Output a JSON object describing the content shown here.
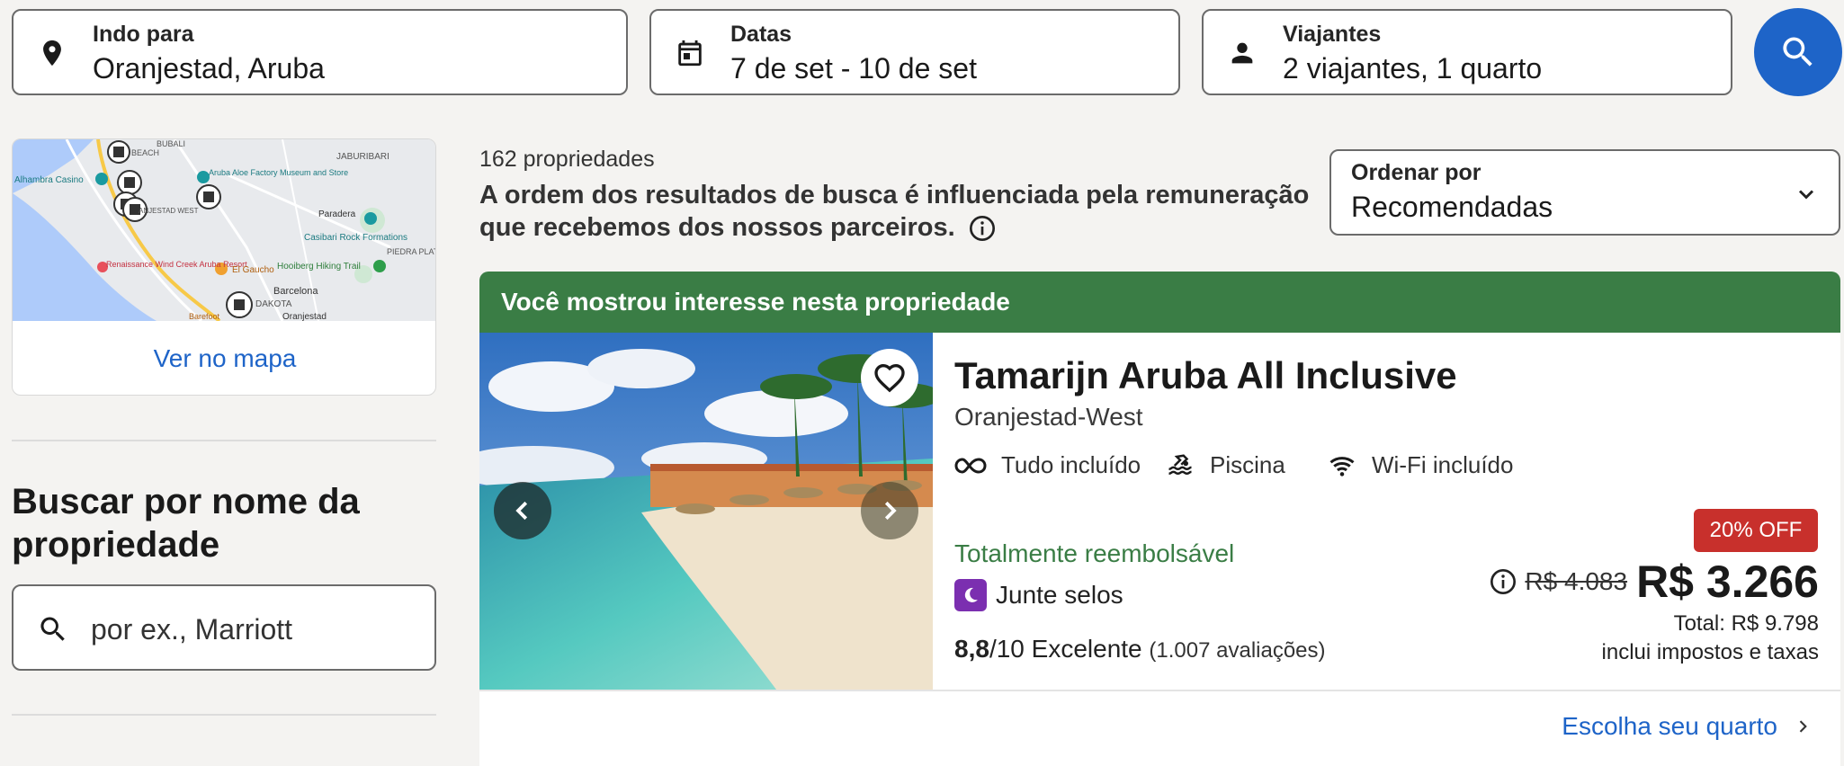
{
  "search": {
    "destination_label": "Indo para",
    "destination_value": "Oranjestad, Aruba",
    "dates_label": "Datas",
    "dates_value": "7 de set - 10 de set",
    "travelers_label": "Viajantes",
    "travelers_value": "2 viajantes, 1 quarto"
  },
  "sidebar": {
    "map_labels": [
      "BEACH",
      "BUBALI",
      "JABURIBARI",
      "Alhambra Casino",
      "Aruba Aloe Factory Museum and Store",
      "ANJESTAD WEST",
      "Paradera",
      "Casibari Rock Formations",
      "PIEDRA PLAT",
      "Renaissance Wind Creek Aruba Resort",
      "El Gaucho",
      "Hooiberg Hiking Trail",
      "Barcelona",
      "DAKOTA",
      "Barefoot",
      "Oranjestad"
    ],
    "map_link": "Ver no mapa",
    "name_search_title": "Buscar por nome da propriedade",
    "name_search_placeholder": "por ex., Marriott"
  },
  "results": {
    "count": "162 propriedades",
    "disclaimer": "A ordem dos resultados de busca é influenciada pela remuneração que recebemos dos nossos parceiros.",
    "sort_label": "Ordenar por",
    "sort_value": "Recomendadas"
  },
  "property": {
    "banner": "Você mostrou interesse nesta propriedade",
    "name": "Tamarijn Aruba All Inclusive",
    "area": "Oranjestad-West",
    "amenities": [
      "Tudo incluído",
      "Piscina",
      "Wi-Fi incluído"
    ],
    "refundable": "Totalmente reembolsável",
    "stamps": "Junte selos",
    "rating_score": "8,8",
    "rating_scale": "/10",
    "rating_word": "Excelente",
    "reviews": "(1.007 avaliações)",
    "discount": "20% OFF",
    "old_price": "R$ 4.083",
    "price": "R$ 3.266",
    "total": "Total: R$ 9.798",
    "taxes": "inclui impostos e taxas",
    "choose_room": "Escolha seu quarto"
  },
  "colors": {
    "accent_blue": "#1e64c8",
    "banner_green": "#3a7d45",
    "discount_red": "#c8302c",
    "stamps_purple": "#7b2fb0"
  },
  "icons": [
    "location-pin-icon",
    "calendar-icon",
    "person-icon",
    "search-icon",
    "info-icon",
    "chevron-down-icon",
    "heart-icon",
    "chevron-left-icon",
    "chevron-right-icon",
    "all-inclusive-icon",
    "pool-icon",
    "wifi-icon",
    "moon-icon"
  ]
}
